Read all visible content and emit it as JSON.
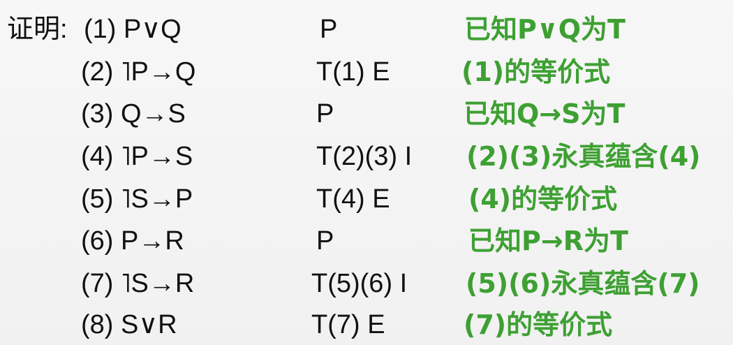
{
  "prefix": "证明:",
  "rows": [
    {
      "step": "(1) P∨Q",
      "rule": "P",
      "note": "已知P∨Q为T"
    },
    {
      "step": "(2) ˥P→Q",
      "rule": "T(1) E",
      "note": "(1)的等价式"
    },
    {
      "step": "(3) Q→S",
      "rule": "P",
      "note": "已知Q→S为T"
    },
    {
      "step": "(4) ˥P→S",
      "rule": "T(2)(3) I",
      "note": "(2)(3)永真蕴含(4)"
    },
    {
      "step": "(5) ˥S→P",
      "rule": "T(4) E",
      "note": "(4)的等价式"
    },
    {
      "step": "(6) P→R",
      "rule": "P",
      "note": "已知P→R为T"
    },
    {
      "step": "(7) ˥S→R",
      "rule": "T(5)(6) I",
      "note": "(5)(6)永真蕴含(7)"
    },
    {
      "step": "(8) S∨R",
      "rule": "T(7) E",
      "note": "(7)的等价式"
    }
  ],
  "colors": {
    "text": "#111111",
    "note": "#3ea033"
  }
}
